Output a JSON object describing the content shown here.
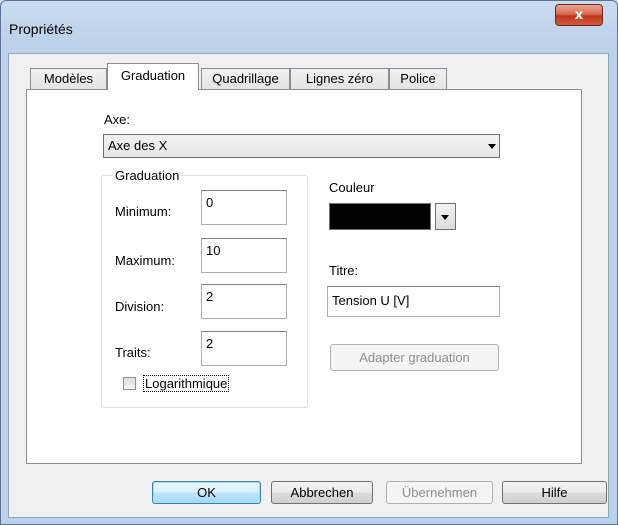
{
  "window": {
    "title": "Propriétés",
    "close_label": "x"
  },
  "tabs": [
    {
      "label": "Modèles",
      "active": false
    },
    {
      "label": "Graduation",
      "active": true
    },
    {
      "label": "Quadrillage",
      "active": false
    },
    {
      "label": "Lignes zéro",
      "active": false
    },
    {
      "label": "Police",
      "active": false
    }
  ],
  "axis": {
    "label": "Axe:",
    "selected": "Axe des X"
  },
  "graduation": {
    "group_label": "Graduation",
    "minimum_label": "Minimum:",
    "minimum_value": "0",
    "maximum_label": "Maximum:",
    "maximum_value": "10",
    "division_label": "Division:",
    "division_value": "2",
    "traits_label": "Traits:",
    "traits_value": "2",
    "log_label": "Logarithmique",
    "log_checked": false
  },
  "color": {
    "label": "Couleur",
    "value": "#000000"
  },
  "title_field": {
    "label": "Titre:",
    "value": "Tension U [V]"
  },
  "adapt_button": "Adapter graduation",
  "footer": {
    "ok": "OK",
    "cancel": "Abbrechen",
    "apply": "Übernehmen",
    "help": "Hilfe"
  }
}
